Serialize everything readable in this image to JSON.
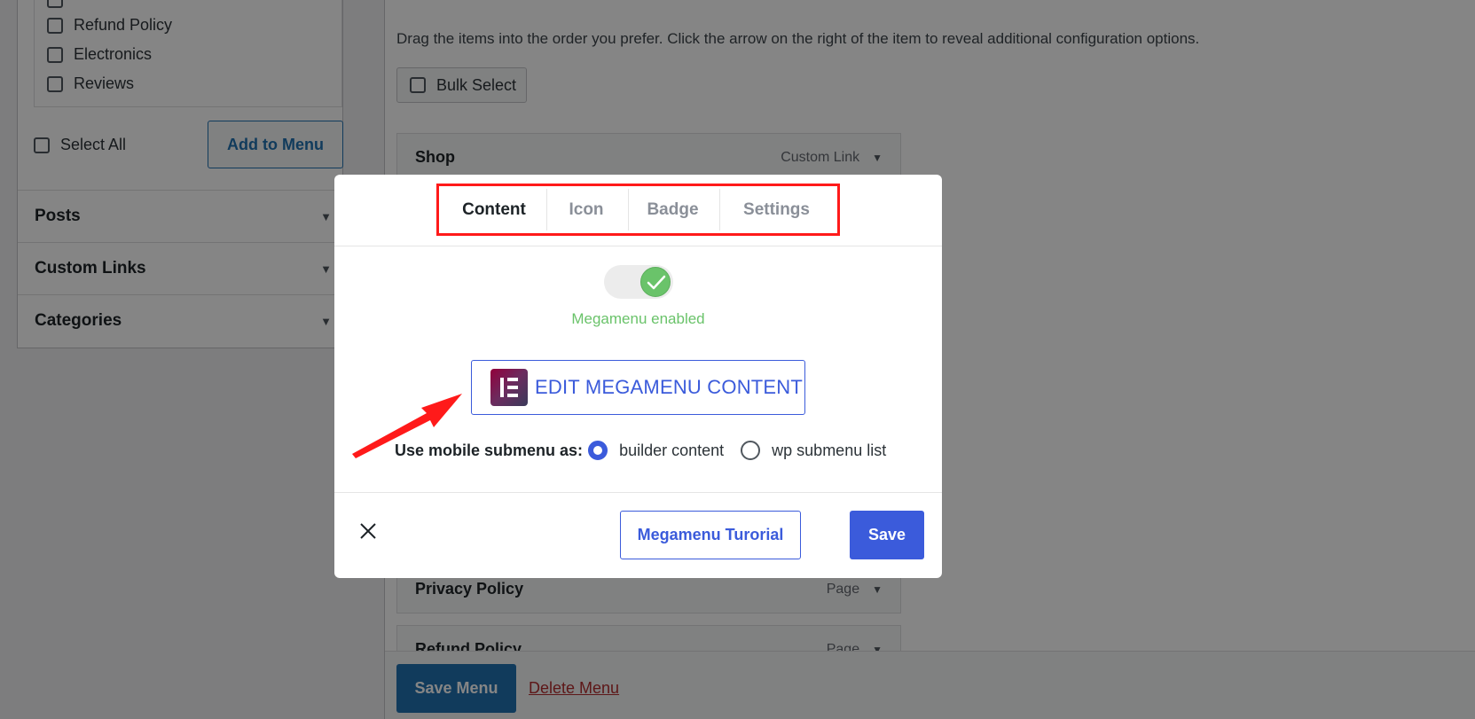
{
  "left_panel": {
    "pages": [
      {
        "label": ""
      },
      {
        "label": "Refund Policy"
      },
      {
        "label": "Electronics"
      },
      {
        "label": "Reviews"
      }
    ],
    "select_all_label": "Select All",
    "add_button_label": "Add to Menu",
    "accordions": [
      {
        "label": "Posts"
      },
      {
        "label": "Custom Links"
      },
      {
        "label": "Categories"
      }
    ]
  },
  "right_panel": {
    "instructions": "Drag the items into the order you prefer. Click the arrow on the right of the item to reveal additional configuration options.",
    "bulk_select_label": "Bulk Select",
    "menu_items": [
      {
        "title": "Shop",
        "type": "Custom Link"
      },
      {
        "title": "Privacy Policy",
        "type": "Page"
      },
      {
        "title": "Refund Policy",
        "type": "Page"
      }
    ],
    "save_menu_label": "Save Menu",
    "delete_menu_label": "Delete Menu"
  },
  "modal": {
    "tabs": [
      {
        "label": "Content",
        "active": true
      },
      {
        "label": "Icon",
        "active": false
      },
      {
        "label": "Badge",
        "active": false
      },
      {
        "label": "Settings",
        "active": false
      }
    ],
    "toggle_enabled": true,
    "status_text": "Megamenu enabled",
    "edit_button_label": "EDIT MEGAMENU CONTENT",
    "mobile_label": "Use mobile submenu as:",
    "mobile_options": [
      {
        "label": "builder content",
        "checked": true
      },
      {
        "label": "wp submenu list",
        "checked": false
      }
    ],
    "tutorial_button_label": "Megamenu Turorial",
    "save_button_label": "Save"
  },
  "colors": {
    "accent": "#3b5bdb",
    "success": "#6ac36a",
    "highlight": "#ff1a1a",
    "wp_blue": "#2271b1",
    "delete_red": "#b32d2e"
  }
}
